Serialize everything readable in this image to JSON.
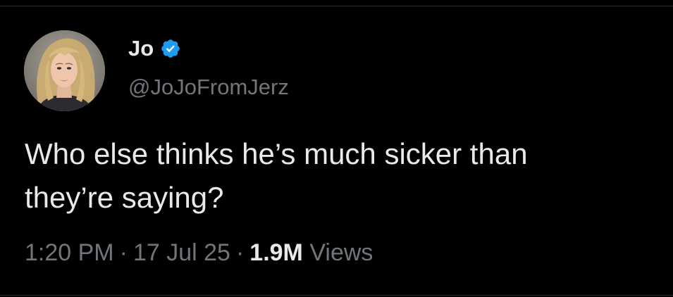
{
  "tweet": {
    "author": {
      "display_name": "Jo",
      "handle": "@JoJoFromJerz",
      "verified": true,
      "verified_icon": "verified-badge-icon",
      "avatar": "profile-photo"
    },
    "text": "Who else thinks he’s much sicker than\nthey’re saying?",
    "time": "1:20 PM",
    "date": "17 Jul 25",
    "separator": "·",
    "views_count": "1.9M",
    "views_label": "Views"
  },
  "colors": {
    "background": "#000000",
    "text_primary": "#e7e9ea",
    "text_secondary": "#71767b",
    "verified_blue": "#1d9bf0",
    "divider": "#2a2d30"
  }
}
